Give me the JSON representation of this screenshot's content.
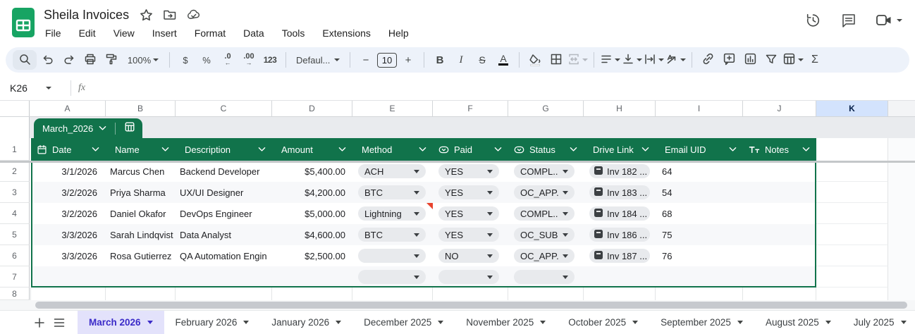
{
  "app": {
    "title": "Sheila Invoices",
    "menus": [
      "File",
      "Edit",
      "View",
      "Insert",
      "Format",
      "Data",
      "Tools",
      "Extensions",
      "Help"
    ]
  },
  "toolbar": {
    "zoom_value": "100%",
    "currency": "$",
    "percent": "%",
    "dec_decrease": ".0",
    "dec_increase": ".00",
    "more_formats": "123",
    "font_name": "Defaul...",
    "font_size": "10",
    "minus": "−",
    "plus": "+",
    "bold": "B",
    "italic": "I",
    "strikethrough": "S",
    "text_color": "A",
    "functions": "Σ"
  },
  "formula_bar": {
    "cell_ref": "K26",
    "fx_label": "fx"
  },
  "grid": {
    "column_letters": [
      "A",
      "B",
      "C",
      "D",
      "E",
      "F",
      "G",
      "H",
      "I",
      "J",
      "K"
    ],
    "selected_column": "K",
    "row_numbers": [
      "1",
      "2",
      "3",
      "4",
      "5",
      "6",
      "7",
      "8"
    ]
  },
  "table": {
    "name": "March_2026",
    "headers": {
      "date": "Date",
      "name": "Name",
      "description": "Description",
      "amount": "Amount",
      "method": "Method",
      "paid": "Paid",
      "status": "Status",
      "drive_link": "Drive Link",
      "email_uid": "Email UID",
      "notes": "Notes"
    },
    "rows": [
      {
        "row": "2",
        "date": "3/1/2026",
        "name": "Marcus Chen",
        "description": "Backend Developer",
        "amount": "$5,400.00",
        "method": "ACH",
        "paid": "YES",
        "status": "COMPL...",
        "drive_link": "Inv 182 ...",
        "email_uid": "64",
        "notes": ""
      },
      {
        "row": "3",
        "date": "3/2/2026",
        "name": "Priya Sharma",
        "description": "UX/UI Designer",
        "amount": "$4,200.00",
        "method": "BTC",
        "paid": "YES",
        "status": "OC_APP...",
        "drive_link": "Inv 183 ...",
        "email_uid": "54",
        "notes": ""
      },
      {
        "row": "4",
        "date": "3/2/2026",
        "name": "Daniel Okafor",
        "description": "DevOps Engineer",
        "amount": "$5,000.00",
        "method": "Lightning",
        "paid": "YES",
        "status": "COMPL...",
        "drive_link": "Inv 184 ...",
        "email_uid": "68",
        "notes": "",
        "has_comment_marker": true
      },
      {
        "row": "5",
        "date": "3/3/2026",
        "name": "Sarah Lindqvist",
        "description": "Data Analyst",
        "amount": "$4,600.00",
        "method": "BTC",
        "paid": "YES",
        "status": "OC_SUB...",
        "drive_link": "Inv 186 ...",
        "email_uid": "75",
        "notes": ""
      },
      {
        "row": "6",
        "date": "3/3/2026",
        "name": "Rosa Gutierrez",
        "description": "QA Automation Engin",
        "amount": "$2,500.00",
        "method": "",
        "paid": "NO",
        "status": "OC_APP...",
        "drive_link": "Inv 187 ...",
        "email_uid": "76",
        "notes": ""
      },
      {
        "row": "7",
        "date": "",
        "name": "",
        "description": "",
        "amount": "",
        "method": "",
        "paid": "",
        "status": "",
        "drive_link": "",
        "email_uid": "",
        "notes": ""
      }
    ]
  },
  "sheet_tabs": {
    "active_tab": "March 2026",
    "tabs": [
      "March 2026",
      "February 2026",
      "January 2026",
      "December 2025",
      "November 2025",
      "October 2025",
      "September 2025",
      "August 2025",
      "July 2025"
    ]
  },
  "colors": {
    "table_green": "#11734b",
    "selected_column_bg": "#d3e3fd",
    "active_tab_bg": "#e3e2fb",
    "active_tab_text": "#3b2bc8",
    "comment_marker": "#e8432d",
    "pill_bg": "#e8eaed",
    "toolbar_bg": "#edf2fa"
  }
}
